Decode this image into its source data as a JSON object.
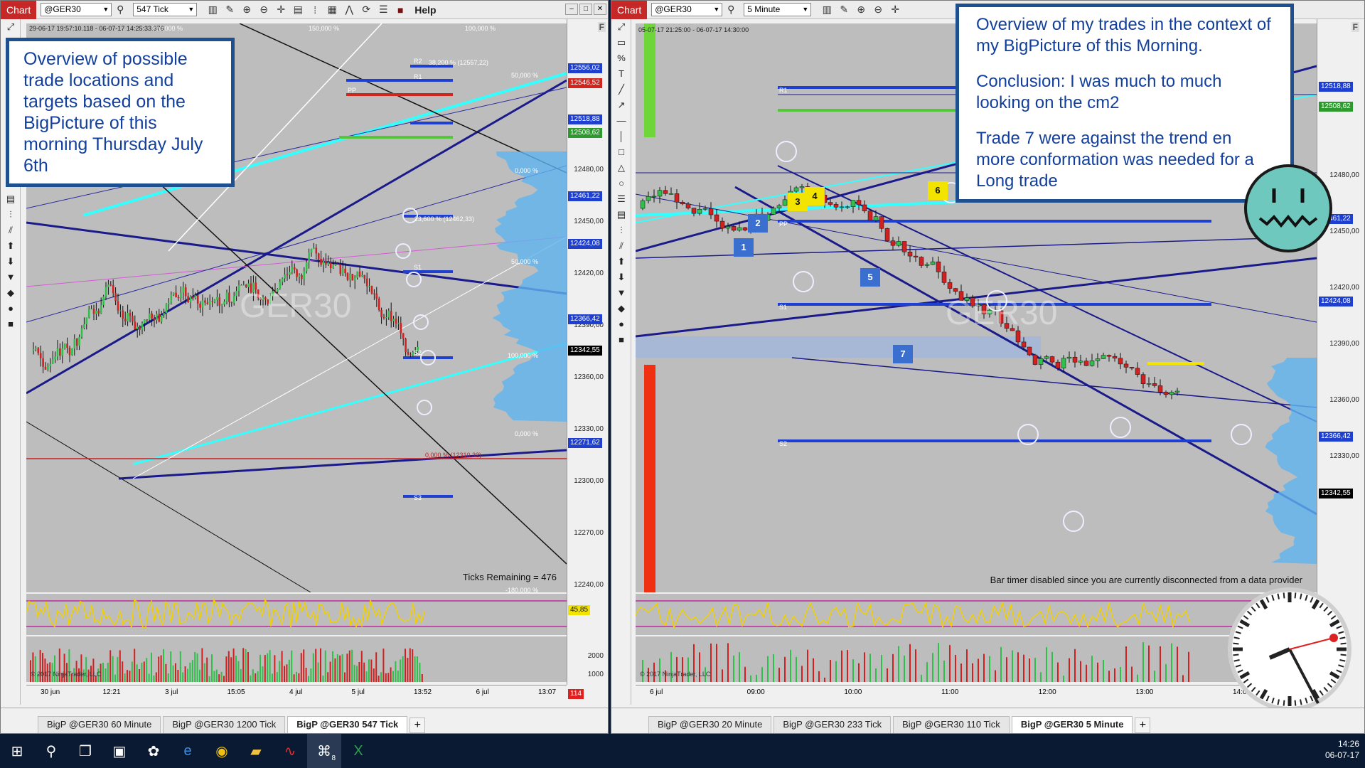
{
  "left": {
    "chart_label": "Chart",
    "instrument": "@GER30",
    "interval": "547 Tick",
    "help_label": "Help",
    "flag": "F",
    "info_line": "29-06-17 19:57:10.118 - 06-07-17 14:25:33.376",
    "watermark": "GER30",
    "annotation": "Overview of possible trade locations and targets based on the BigPicture of this morning Thursday July 6th",
    "ticks_remaining": "Ticks Remaining = 476",
    "copyright": "© 2017 NinjaTrader, LLC",
    "price_axis": [
      "12480,00",
      "12450,00",
      "12420,00",
      "12390,00",
      "12360,00",
      "12330,00",
      "12300,00",
      "12270,00",
      "12240,00"
    ],
    "price_boxes": [
      {
        "label": "12556,02",
        "color": "#1e3fd0"
      },
      {
        "label": "12546,52",
        "color": "#d0261e"
      },
      {
        "label": "12518,88",
        "color": "#1e3fd0"
      },
      {
        "label": "12508,62",
        "color": "#2d9a2d"
      },
      {
        "label": "12461,22",
        "color": "#1e3fd0"
      },
      {
        "label": "12424,08",
        "color": "#1e3fd0"
      },
      {
        "label": "12366,42",
        "color": "#1e3fd0"
      },
      {
        "label": "12342,55",
        "color": "#000000"
      },
      {
        "label": "12271,62",
        "color": "#1e3fd0"
      }
    ],
    "fib_labels": [
      "200,000 %",
      "150,000 %",
      "100,000 %",
      "38,200 % (12557,22)",
      "50,000 %",
      "0,000 %",
      "23,600 % (12462,33)",
      "50,000 %",
      "100,000 %",
      "0,000 %",
      "0,000 % (12310,32)",
      "-180,000 %"
    ],
    "level_labels": [
      "R2",
      "R1",
      "PP",
      "S1",
      "S2",
      "S3"
    ],
    "oscillator_value": "45,85",
    "volume_axis": [
      "2000",
      "1000"
    ],
    "volume_value": "114",
    "time_axis": [
      "30 jun",
      "12:21",
      "3 jul",
      "15:05",
      "4 jul",
      "5 jul",
      "13:52",
      "6 jul",
      "13:07"
    ],
    "tabs": [
      "BigP @GER30 60 Minute",
      "BigP @GER30 1200 Tick",
      "BigP @GER30 547 Tick"
    ]
  },
  "right": {
    "chart_label": "Chart",
    "instrument": "@GER30",
    "interval": "5 Minute",
    "flag": "F",
    "info_line": "05-07-17 21:25:00 - 06-07-17 14:30:00",
    "watermark": "GER30",
    "annotation_lines": [
      "Overview of my trades in the context of my BigPicture of this Morning.",
      "Conclusion: I was much to much looking on the cm2",
      "Trade 7 were against the trend en more conformation was needed for a Long trade"
    ],
    "bar_timer": "Bar timer disabled since you are currently disconnected from a data provider",
    "copyright": "© 2017 NinjaTrader, LLC",
    "trade_markers": [
      "1",
      "2",
      "3",
      "4",
      "5",
      "6",
      "7"
    ],
    "price_axis": [
      "12480,00",
      "12450,00",
      "12420,00",
      "12390,00",
      "12360,00",
      "12330,00"
    ],
    "price_boxes": [
      {
        "label": "12518,88",
        "color": "#1e3fd0"
      },
      {
        "label": "12508,62",
        "color": "#2d9a2d"
      },
      {
        "label": "12461,22",
        "color": "#1e3fd0"
      },
      {
        "label": "12424,08",
        "color": "#1e3fd0"
      },
      {
        "label": "12366,42",
        "color": "#1e3fd0"
      },
      {
        "label": "12342,55",
        "color": "#000000"
      }
    ],
    "level_labels": [
      "R1",
      "PP",
      "S1",
      "S2"
    ],
    "time_axis": [
      "6 jul",
      "09:00",
      "10:00",
      "11:00",
      "12:00",
      "13:00",
      "14:00"
    ],
    "tabs": [
      "BigP @GER30 20 Minute",
      "BigP @GER30 233 Tick",
      "BigP @GER30 110 Tick",
      "BigP @GER30 5 Minute"
    ]
  },
  "taskbar": {
    "time": "14:26",
    "date": "06-07-17",
    "badge": "8"
  }
}
